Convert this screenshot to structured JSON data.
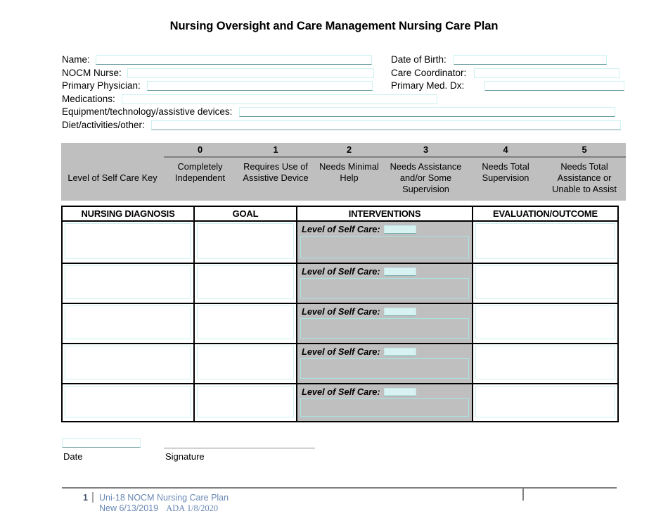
{
  "document": {
    "title": "Nursing Oversight and Care Management Nursing Care Plan"
  },
  "header_form": {
    "left_fields": [
      {
        "label": "Name:",
        "value": ""
      },
      {
        "label": "NOCM Nurse:",
        "value": ""
      },
      {
        "label": "Primary Physician:",
        "value": ""
      },
      {
        "label": "Medications:",
        "value": ""
      },
      {
        "label": "Equipment/technology/assistive devices:",
        "value": ""
      },
      {
        "label": "Diet/activities/other:",
        "value": ""
      }
    ],
    "right_fields": [
      {
        "label": "Date of Birth:",
        "value": ""
      },
      {
        "label": "Care Coordinator:",
        "value": ""
      },
      {
        "label": "Primary Med. Dx:",
        "value": ""
      }
    ]
  },
  "self_care_key": {
    "title": "Level of Self Care Key",
    "levels": [
      {
        "number": "0",
        "description": "Completely Independent"
      },
      {
        "number": "1",
        "description": "Requires Use of Assistive Device"
      },
      {
        "number": "2",
        "description": "Needs Minimal Help"
      },
      {
        "number": "3",
        "description": "Needs Assistance and/or Some Supervision"
      },
      {
        "number": "4",
        "description": "Needs Total Supervision"
      },
      {
        "number": "5",
        "description": "Needs Total Assistance or Unable to Assist"
      }
    ]
  },
  "care_plan_table": {
    "columns": [
      "NURSING DIAGNOSIS",
      "GOAL",
      "INTERVENTIONS",
      "EVALUATION/OUTCOME"
    ],
    "intervention_label": "Level of Self Care:",
    "rows": [
      {
        "nursing_diagnosis": "",
        "goal": "",
        "level_of_self_care": "",
        "interventions": "",
        "evaluation_outcome": ""
      },
      {
        "nursing_diagnosis": "",
        "goal": "",
        "level_of_self_care": "",
        "interventions": "",
        "evaluation_outcome": ""
      },
      {
        "nursing_diagnosis": "",
        "goal": "",
        "level_of_self_care": "",
        "interventions": "",
        "evaluation_outcome": ""
      },
      {
        "nursing_diagnosis": "",
        "goal": "",
        "level_of_self_care": "",
        "interventions": "",
        "evaluation_outcome": ""
      },
      {
        "nursing_diagnosis": "",
        "goal": "",
        "level_of_self_care": "",
        "interventions": "",
        "evaluation_outcome": ""
      }
    ]
  },
  "signature_block": {
    "date_value": "",
    "date_label": "Date",
    "signature_label": "Signature"
  },
  "footer": {
    "page_number": "1",
    "line1": "Uni-18 NOCM Nursing Care Plan",
    "line2_new": "New 6/13/2019",
    "line2_ada": "ADA 1/8/2020"
  },
  "colors": {
    "key_background": "#BFBFBF",
    "field_border": "#CDF0F0",
    "field_underline": "#6F9FA3",
    "table_border": "#000000",
    "footer_text": "#6A89B5",
    "footer_pageno": "#44546A",
    "rule_gray": "#808080"
  }
}
